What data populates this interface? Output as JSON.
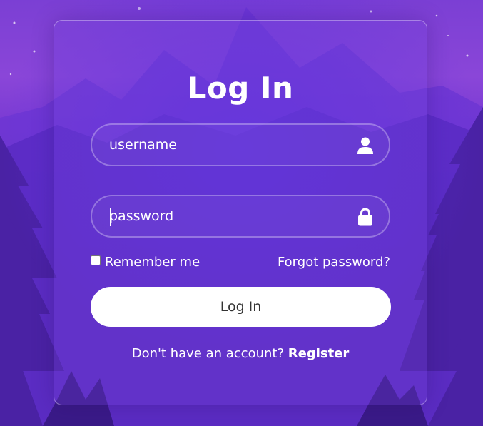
{
  "login": {
    "title": "Log In",
    "username_placeholder": "username",
    "password_placeholder": "password",
    "remember_label": "Remember me",
    "forgot_link": "Forgot password?",
    "submit_label": "Log In",
    "register_prompt": "Don't have an account?",
    "register_link": "Register"
  },
  "icons": {
    "username": "user-icon",
    "password": "lock-icon"
  },
  "colors": {
    "accent_purple": "#6a2fcf",
    "button_bg": "#ffffff",
    "button_text": "#333333",
    "text": "#ffffff"
  }
}
